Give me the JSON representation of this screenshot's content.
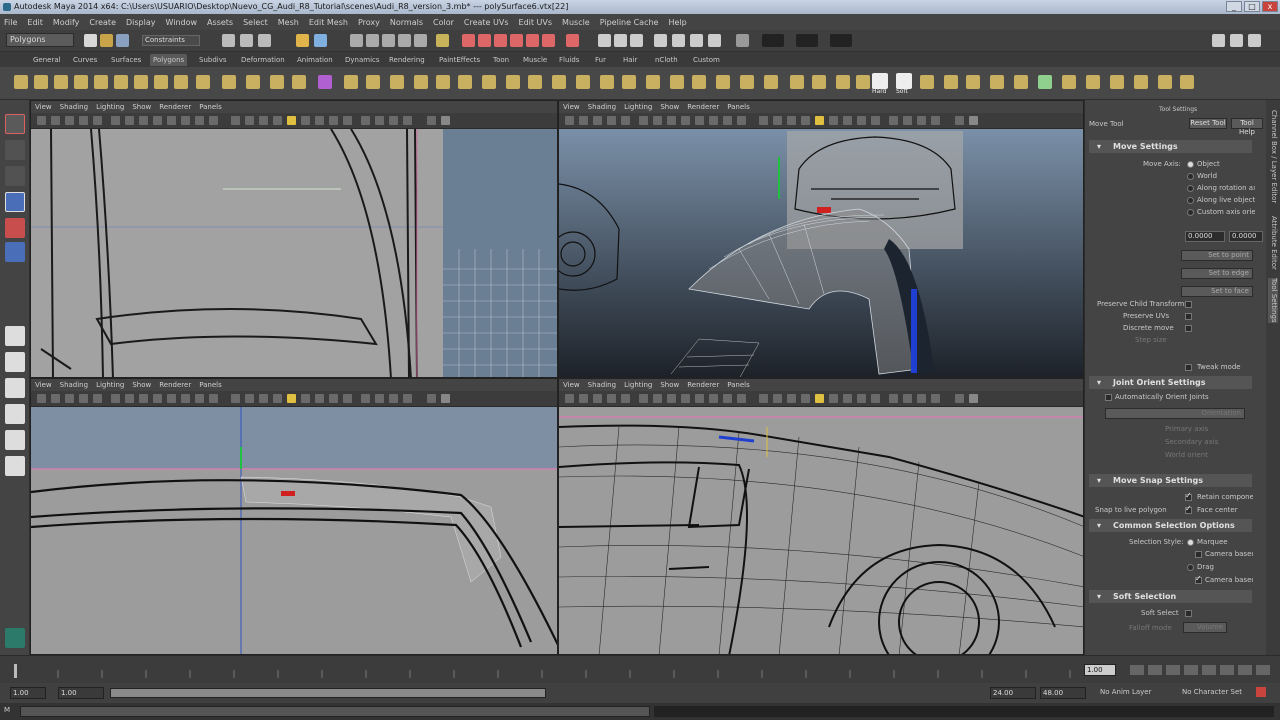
{
  "window": {
    "title": "Autodesk Maya 2014 x64: C:\\Users\\USUARIO\\Desktop\\Nuevo_CG_Audi_R8_Tutorial\\scenes\\Audi_R8_version_3.mb* --- polySurface6.vtx[22]",
    "minimize": "_",
    "maximize": "□",
    "close": "x"
  },
  "menubar": [
    "File",
    "Edit",
    "Modify",
    "Create",
    "Display",
    "Window",
    "Assets",
    "Select",
    "Mesh",
    "Edit Mesh",
    "Proxy",
    "Normals",
    "Color",
    "Create UVs",
    "Edit UVs",
    "Muscle",
    "Pipeline Cache",
    "Help"
  ],
  "status_line": {
    "mode": "Polygons",
    "field_label": "Constraints"
  },
  "shelf_tabs": {
    "items": [
      "General",
      "Curves",
      "Surfaces",
      "Polygons",
      "Subdivs",
      "Deformation",
      "Animation",
      "Dynamics",
      "Rendering",
      "PaintEffects",
      "Toon",
      "Muscle",
      "Fluids",
      "Fur",
      "Hair",
      "nCloth",
      "Custom"
    ],
    "active": "Polygons"
  },
  "shelf": {
    "hard_label": "Hard",
    "soft_label": "Soft"
  },
  "viewport_menu": [
    "View",
    "Shading",
    "Lighting",
    "Show",
    "Renderer",
    "Panels"
  ],
  "attribute_editor": {
    "panel_title": "Tool Settings",
    "tool_name": "Move Tool",
    "reset_button": "Reset Tool",
    "help_button": "Tool Help",
    "move_settings": {
      "header": "Move Settings",
      "move_axis_label": "Move Axis:",
      "options": [
        "Object",
        "World",
        "Along rotation axis",
        "Along live object axis",
        "Custom axis orientation"
      ],
      "selected": "Object",
      "value_a": "0.0000",
      "value_b": "0.0000",
      "buttons": [
        "Set to point",
        "Set to edge",
        "Set to face"
      ],
      "preserve_uvs_label": "Preserve Child Transforms",
      "preserve_uvs": "Preserve UVs",
      "discrete_label": "Discrete move",
      "step_label": "Step size",
      "tweak_mode": "Tweak mode"
    },
    "joint_orient": {
      "header": "Joint Orient Settings",
      "auto_orient": "Automatically Orient Joints",
      "orientation_label": "Orientation",
      "primary": "Primary axis",
      "secondary": "Secondary axis",
      "world_orient": "World orient"
    },
    "snap": {
      "header": "Move Snap Settings",
      "retain": "Retain component spacing",
      "snap_live": "Snap to live polygon",
      "face_center": "Face center"
    },
    "common": {
      "header": "Common Selection Options",
      "selection_style_label": "Selection Style:",
      "marquee": "Marquee",
      "camera_based": "Camera based selection",
      "drag": "Drag",
      "camera_based_paint": "Camera based paint selection"
    },
    "soft": {
      "header": "Soft Selection",
      "soft_select": "Soft Select",
      "falloff_mode": "Falloff mode",
      "falloff_value": "Volume"
    }
  },
  "side_tabs": [
    "Channel Box / Layer Editor",
    "Attribute Editor",
    "Tool Settings"
  ],
  "timeline": {
    "current_frame": "1.00",
    "range_start": "1.00",
    "range_inner_start": "1.00",
    "range_end_inner": "24.00",
    "range_end": "48.00",
    "anim_layer": "No Anim Layer",
    "char_set": "No Character Set"
  },
  "colors": {
    "accent_red": "#c8443c",
    "grid_blue": "#5b6f86",
    "wire": "#1a1a1a"
  }
}
